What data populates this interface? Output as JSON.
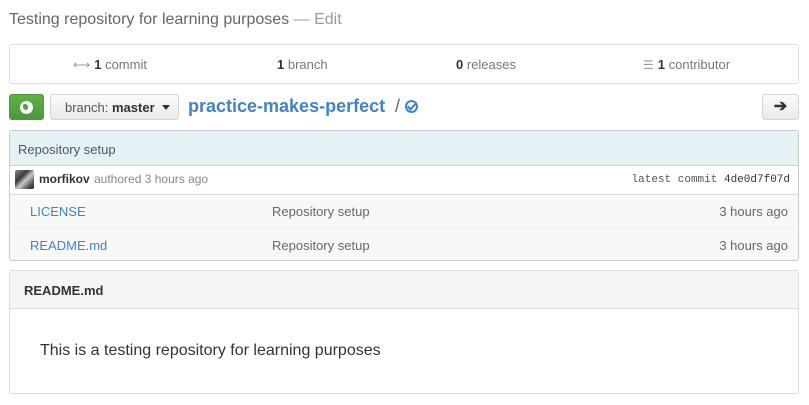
{
  "repo": {
    "description": "Testing repository for learning purposes",
    "edit_separator": "—",
    "edit_label": "Edit",
    "name": "practice-makes-perfect",
    "slash": "/"
  },
  "stats": {
    "commits": {
      "count": "1",
      "label": "commit",
      "icon": "history-icon"
    },
    "branches": {
      "count": "1",
      "label": "branch"
    },
    "releases": {
      "count": "0",
      "label": "releases"
    },
    "contributors": {
      "count": "1",
      "label": "contributor",
      "icon": "organization-icon"
    }
  },
  "toolbar": {
    "branch_prefix": "branch:",
    "branch_value": "master",
    "next_arrow": "➔"
  },
  "last_commit": {
    "message": "Repository setup",
    "author": "morfikov",
    "authored_text": "authored 3 hours ago",
    "latest_label": "latest commit",
    "sha": "4de0d7f07d"
  },
  "files": [
    {
      "name": "LICENSE",
      "message": "Repository setup",
      "age": "3 hours ago"
    },
    {
      "name": "README.md",
      "message": "Repository setup",
      "age": "3 hours ago"
    }
  ],
  "readme": {
    "title": "README.md",
    "body": "This is a testing repository for learning purposes"
  },
  "colors": {
    "link": "#4183c4",
    "clone_green": "#60b044",
    "commit_header_bg": "#e6f1f6"
  }
}
